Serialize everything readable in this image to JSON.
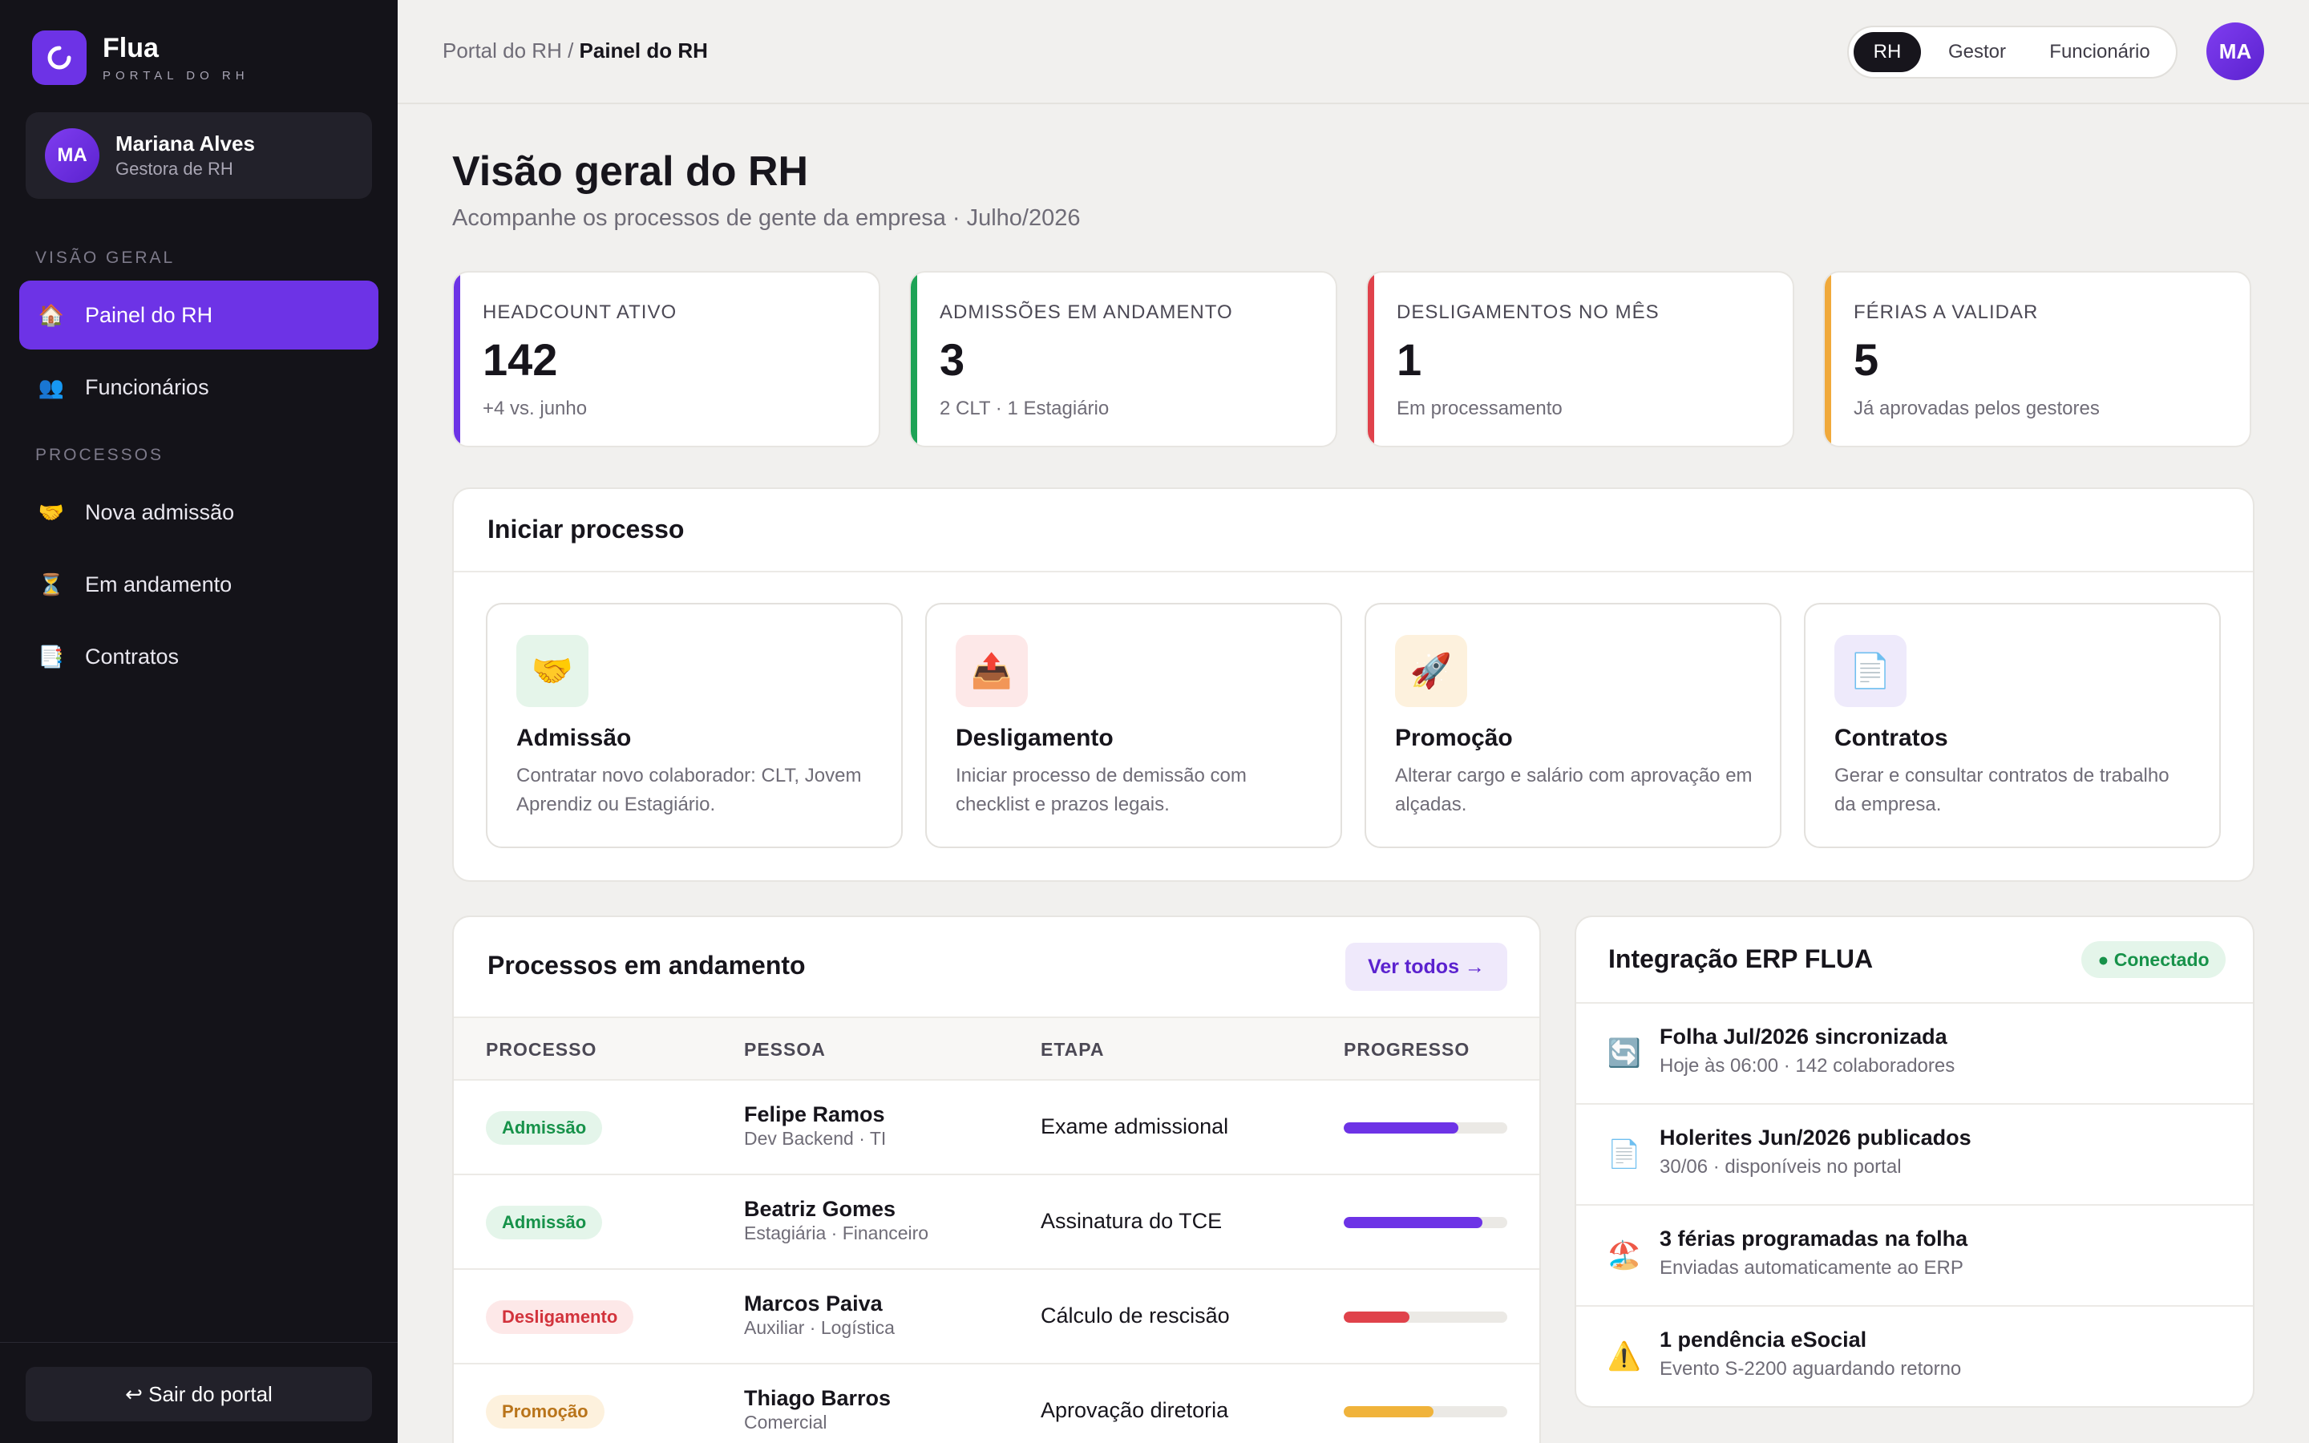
{
  "brand": {
    "name": "Flua",
    "subtitle": "PORTAL DO RH"
  },
  "user": {
    "initials": "MA",
    "name": "Mariana Alves",
    "role": "Gestora de RH"
  },
  "nav": {
    "section_overview": "VISÃO GERAL",
    "section_processes": "PROCESSOS",
    "items": [
      {
        "icon": "🏠",
        "icon_name": "house-icon",
        "label": "Painel do RH",
        "active": true
      },
      {
        "icon": "👥",
        "icon_name": "people-icon",
        "label": "Funcionários"
      },
      {
        "icon": "🤝",
        "icon_name": "handshake-icon",
        "label": "Nova admissão"
      },
      {
        "icon": "⏳",
        "icon_name": "hourglass-icon",
        "label": "Em andamento"
      },
      {
        "icon": "📑",
        "icon_name": "contracts-icon",
        "label": "Contratos"
      }
    ],
    "logout": "↩ Sair do portal"
  },
  "topbar": {
    "breadcrumb_root": "Portal do RH",
    "breadcrumb_sep": " / ",
    "breadcrumb_current": "Painel do RH",
    "roles": [
      "RH",
      "Gestor",
      "Funcionário"
    ],
    "active_role": "RH",
    "avatar_initials": "MA"
  },
  "page": {
    "title": "Visão geral do RH",
    "subtitle": "Acompanhe os processos de gente da empresa · Julho/2026"
  },
  "stats": [
    {
      "label": "HEADCOUNT ATIVO",
      "value": "142",
      "note": "+4 vs. junho",
      "color": "#6d33e6"
    },
    {
      "label": "ADMISSÕES EM ANDAMENTO",
      "value": "3",
      "note": "2 CLT · 1 Estagiário",
      "color": "#1ea356"
    },
    {
      "label": "DESLIGAMENTOS NO MÊS",
      "value": "1",
      "note": "Em processamento",
      "color": "#e0424b"
    },
    {
      "label": "FÉRIAS A VALIDAR",
      "value": "5",
      "note": "Já aprovadas pelos gestores",
      "color": "#f0a93b"
    }
  ],
  "start_process": {
    "title": "Iniciar processo",
    "actions": [
      {
        "icon": "🤝",
        "icon_name": "handshake-icon",
        "bg": "#e5f5ea",
        "title": "Admissão",
        "desc": "Contratar novo colaborador: CLT, Jovem Aprendiz ou Estagiário."
      },
      {
        "icon": "📤",
        "icon_name": "outbox-icon",
        "bg": "#fde8e8",
        "title": "Desligamento",
        "desc": "Iniciar processo de demissão com checklist e prazos legais."
      },
      {
        "icon": "🚀",
        "icon_name": "rocket-icon",
        "bg": "#fdf1dd",
        "title": "Promoção",
        "desc": "Alterar cargo e salário com aprovação em alçadas."
      },
      {
        "icon": "📄",
        "icon_name": "document-icon",
        "bg": "#eeeafb",
        "title": "Contratos",
        "desc": "Gerar e consultar contratos de trabalho da empresa."
      }
    ]
  },
  "processes": {
    "title": "Processos em andamento",
    "view_all": "Ver todos →",
    "headers": [
      "PROCESSO",
      "PESSOA",
      "ETAPA",
      "PROGRESSO"
    ],
    "rows": [
      {
        "tag": "Admissão",
        "tag_bg": "#e4f5ea",
        "tag_color": "#17924a",
        "name": "Felipe Ramos",
        "dept": "Dev Backend · TI",
        "stage": "Exame admissional",
        "progress": 0.7,
        "bar_color": "#6d33e6"
      },
      {
        "tag": "Admissão",
        "tag_bg": "#e4f5ea",
        "tag_color": "#17924a",
        "name": "Beatriz Gomes",
        "dept": "Estagiária · Financeiro",
        "stage": "Assinatura do TCE",
        "progress": 0.85,
        "bar_color": "#6d33e6"
      },
      {
        "tag": "Desligamento",
        "tag_bg": "#fde8e8",
        "tag_color": "#d2333c",
        "name": "Marcos Paiva",
        "dept": "Auxiliar · Logística",
        "stage": "Cálculo de rescisão",
        "progress": 0.4,
        "bar_color": "#e0424b"
      },
      {
        "tag": "Promoção",
        "tag_bg": "#fdf1dd",
        "tag_color": "#b9741a",
        "name": "Thiago Barros",
        "dept": "Comercial",
        "stage": "Aprovação diretoria",
        "progress": 0.55,
        "bar_color": "#f0b33b"
      }
    ]
  },
  "erp": {
    "title": "Integração ERP FLUA",
    "status": "● Conectado",
    "items": [
      {
        "icon": "🔄",
        "icon_name": "sync-icon",
        "title": "Folha Jul/2026 sincronizada",
        "sub": "Hoje às 06:00 · 142 colaboradores"
      },
      {
        "icon": "📄",
        "icon_name": "document-icon",
        "title": "Holerites Jun/2026 publicados",
        "sub": "30/06 · disponíveis no portal"
      },
      {
        "icon": "🏖️",
        "icon_name": "beach-icon",
        "title": "3 férias programadas na folha",
        "sub": "Enviadas automaticamente ao ERP"
      },
      {
        "icon": "⚠️",
        "icon_name": "warning-icon",
        "title": "1 pendência eSocial",
        "sub": "Evento S-2200 aguardando retorno"
      }
    ]
  }
}
